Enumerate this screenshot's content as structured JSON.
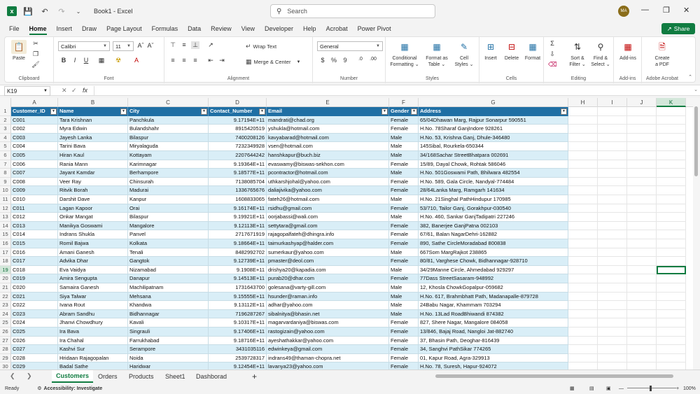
{
  "app": {
    "doc_title": "Book1 - Excel",
    "search_placeholder": "Search",
    "user_initials": "MA",
    "share_label": "Share"
  },
  "menu": [
    "File",
    "Home",
    "Insert",
    "Draw",
    "Page Layout",
    "Formulas",
    "Data",
    "Review",
    "View",
    "Developer",
    "Help",
    "Acrobat",
    "Power Pivot"
  ],
  "ribbon": {
    "clipboard": {
      "label": "Clipboard",
      "paste": "Paste"
    },
    "font": {
      "label": "Font",
      "name": "Calibri",
      "size": "11"
    },
    "alignment": {
      "label": "Alignment",
      "wrap": "Wrap Text",
      "merge": "Merge & Center"
    },
    "number": {
      "label": "Number",
      "format": "General"
    },
    "styles": {
      "label": "Styles",
      "conditional": [
        "Conditional",
        "Formatting ⌄"
      ],
      "format_table": [
        "Format as",
        "Table ⌄"
      ],
      "cell_styles": [
        "Cell",
        "Styles ⌄"
      ]
    },
    "cells": {
      "label": "Cells",
      "insert": "Insert",
      "delete": "Delete",
      "format": "Format"
    },
    "editing": {
      "label": "Editing",
      "sort": [
        "Sort &",
        "Filter ⌄"
      ],
      "find": [
        "Find &",
        "Select ⌄"
      ]
    },
    "addins": {
      "label": "Add-ins",
      "btn": "Add-ins"
    },
    "acrobat": {
      "label": "Adobe Acrobat",
      "btn": [
        "Create",
        "a PDF"
      ]
    }
  },
  "formula_bar": {
    "name_box": "K19",
    "fx": "fx"
  },
  "columns": [
    "A",
    "B",
    "C",
    "D",
    "E",
    "F",
    "G",
    "H",
    "I",
    "J",
    "K"
  ],
  "headers": [
    "Customer_ID",
    "Name",
    "City",
    "Contact_Number",
    "Email",
    "Gender",
    "Address"
  ],
  "rows": [
    [
      "C001",
      "Tara Krishnan",
      "Panchkula",
      "9.17194E+11",
      "mandrati@chad.org",
      "Female",
      "65/04Dhawan Marg, Rajpur Sonarpur 590551"
    ],
    [
      "C002",
      "Myra Edwin",
      "Bulandshahr",
      "8915420519",
      "yshukla@hotmail.com",
      "Female",
      "H.No. 78Sharaf GanjIndore 928261"
    ],
    [
      "C003",
      "Jayesh Lanka",
      "Bilaspur",
      "7400208126",
      "kavyabarad@hotmail.com",
      "Male",
      "H.No. 53, Krishna Ganj, Dhule-346480"
    ],
    [
      "C004",
      "Tarini Bava",
      "Miryalaguda",
      "7232349928",
      "vsen@hotmail.com",
      "Male",
      "145Sibal, Rourkela-650344"
    ],
    [
      "C005",
      "Hiran Kaul",
      "Kottayam",
      "2207644242",
      "hanshkapur@buch.biz",
      "Male",
      "34/168Sachar StreetBhatpara 002691"
    ],
    [
      "C006",
      "Rania Mann",
      "Karimnagar",
      "9.19364E+11",
      "evaswamy@biswas-sekhon.com",
      "Female",
      "15/89, Dayal Chowk, Rohtak 586046"
    ],
    [
      "C007",
      "Jayant Kamdar",
      "Berhampore",
      "9.18577E+11",
      "pcontractor@hotmail.com",
      "Male",
      "H.No. 501Goswami Path, Bhilwara 482554"
    ],
    [
      "C008",
      "Veer Ray",
      "Chinsurah",
      "7138085704",
      "uthkarshjohal@yahoo.com",
      "Female",
      "H.No. 589, Gala Circle, Nandyal-774484"
    ],
    [
      "C009",
      "Ritvik Borah",
      "Madurai",
      "1336765676",
      "daliajivika@yahoo.com",
      "Female",
      "28/64Lanka Marg, Ramgarh 141634"
    ],
    [
      "C010",
      "Darshit Dave",
      "Kanpur",
      "1608833065",
      "fateh26@hotmail.com",
      "Male",
      "H.No. 21Singhal PathHindupur 170985"
    ],
    [
      "C011",
      "Lagan Kapoor",
      "Orai",
      "9.16174E+11",
      "rsidhu@gmail.com",
      "Female",
      "53/710, Tailor Ganj, Gorakhpur-030540"
    ],
    [
      "C012",
      "Onkar Mangat",
      "Bilaspur",
      "9.19921E+11",
      "oorjabassi@wali.com",
      "Male",
      "H.No. 460, Sankar GanjTadipatri 227246"
    ],
    [
      "C013",
      "Manikya Goswami",
      "Mangalore",
      "9.12113E+11",
      "settytara@gmail.com",
      "Female",
      "382, Banerjee GanjPatna 002103"
    ],
    [
      "C014",
      "Indrans Shukla",
      "Panvel",
      "2717671919",
      "rajagopalfateh@dhingra.info",
      "Female",
      "67/61, Balan NagarDehri-162882"
    ],
    [
      "C015",
      "Romil Bajwa",
      "Kolkata",
      "9.18664E+11",
      "taimurkashyap@halder.com",
      "Female",
      "890, Sathe CircleMoradabad 800838"
    ],
    [
      "C016",
      "Amani Ganesh",
      "Tenali",
      "8482992702",
      "sumerkaur@yahoo.com",
      "Male",
      "667Som MargRajkot 238865"
    ],
    [
      "C017",
      "Advika Dhar",
      "Gangtok",
      "9.12739E+11",
      "pmaster@deol.com",
      "Female",
      "80/81, Varghese Chowk, Bidhannagar-928710"
    ],
    [
      "C018",
      "Eva Vaidya",
      "Nizamabad",
      "9.1908E+11",
      "drishya20@kapadia.com",
      "Male",
      "34/29Manne Circle, Ahmedabad 929297"
    ],
    [
      "C019",
      "Amira Sengupta",
      "Danapur",
      "9.14513E+11",
      "purab20@dhar.com",
      "Female",
      "77Dass StreetSasaram-948992"
    ],
    [
      "C020",
      "Samaira Ganesh",
      "Machilipatnam",
      "1731643700",
      "golesana@varty-gill.com",
      "Male",
      "12, Khosla ChowkGopalpur-059682"
    ],
    [
      "C021",
      "Siya Talwar",
      "Mehsana",
      "9.15555E+11",
      "hsunder@raman.info",
      "Male",
      "H.No. 617, Brahmbhatt Path, Madanapalle-879728"
    ],
    [
      "C022",
      "Ivana Rout",
      "Khandwa",
      "9.13112E+11",
      "adhar@yahoo.com",
      "Male",
      "24Babu Nagar, Khammam 703294"
    ],
    [
      "C023",
      "Abram Sandhu",
      "Bidhannagar",
      "7196287267",
      "sibalnitya@bhasin.net",
      "Male",
      "H.No. 13Lad RoadBhiwandi 874382"
    ],
    [
      "C024",
      "Jhanvi Chowdhury",
      "Kavali",
      "9.10317E+11",
      "magarvardaniya@biswas.com",
      "Female",
      "827, Shere Nagar, Mangalore 084058"
    ],
    [
      "C025",
      "Ira Bava",
      "Singrauli",
      "9.17406E+11",
      "rastogizain@yahoo.com",
      "Female",
      "13/846, Bajaj Road, Nangloi Jat-882740"
    ],
    [
      "C026",
      "Ira Chahal",
      "Farrukhabad",
      "9.18716E+11",
      "ayeshathakkar@yahoo.com",
      "Female",
      "37, Bhasin Path, Deoghar-816439"
    ],
    [
      "C027",
      "Kashvi Sur",
      "Serampore",
      "3431035116",
      "edwinkeya@gmail.com",
      "Female",
      "34, Sanghvi PathSikar 774265"
    ],
    [
      "C028",
      "Hridaan Rajagopalan",
      "Noida",
      "2539728317",
      "indrans49@thaman-chopra.net",
      "Female",
      "01, Kapur Road, Agra-329913"
    ],
    [
      "C029",
      "Badal Sathe",
      "Haridwar",
      "9.12454E+11",
      "lavanya23@yahoo.com",
      "Female",
      "H.No. 78, Suresh, Hapur-924072"
    ]
  ],
  "sheets": [
    "Customers",
    "Orders",
    "Products",
    "Sheet1",
    "Dashborad"
  ],
  "status": {
    "ready": "Ready",
    "accessibility": "Accessibility: Investigate",
    "zoom": "100%"
  }
}
